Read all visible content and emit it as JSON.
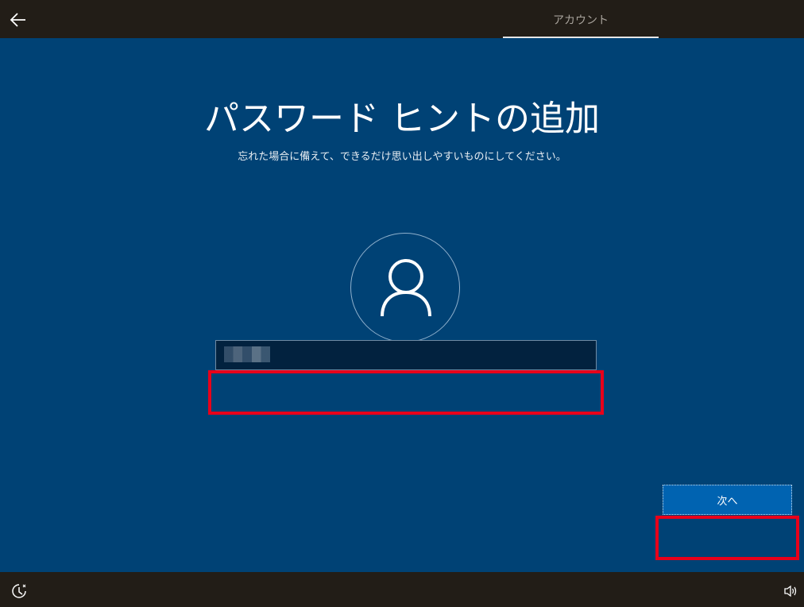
{
  "header": {
    "back_icon": "back-arrow-icon",
    "tab_label": "アカウント"
  },
  "main": {
    "title": "パスワード ヒントの追加",
    "subtitle": "忘れた場合に備えて、できるだけ思い出しやすいものにしてください。",
    "avatar_icon": "user-icon",
    "hint_input": {
      "value": "",
      "placeholder": ""
    },
    "next_button_label": "次へ"
  },
  "footer": {
    "accessibility_icon": "ease-of-access-icon",
    "volume_icon": "speaker-icon"
  },
  "colors": {
    "background": "#004275",
    "bars": "#221d17",
    "highlight": "#e8001a",
    "button": "#0063b1"
  }
}
